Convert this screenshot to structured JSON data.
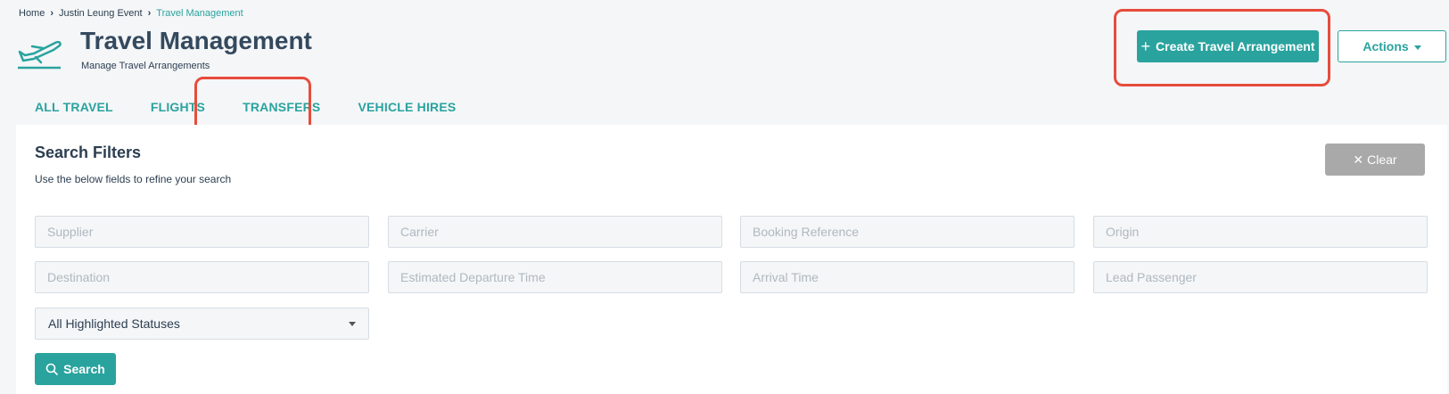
{
  "breadcrumb": {
    "items": [
      "Home",
      "Justin Leung Event",
      "Travel Management"
    ]
  },
  "header": {
    "icon": "plane-icon",
    "title": "Travel Management",
    "subtitle": "Manage Travel Arrangements"
  },
  "toolbar": {
    "create_label": "Create Travel Arrangement",
    "actions_label": "Actions"
  },
  "tabs": [
    {
      "label": "ALL TRAVEL"
    },
    {
      "label": "FLIGHTS"
    },
    {
      "label": "TRANSFERS"
    },
    {
      "label": "VEHICLE HIRES"
    }
  ],
  "filters": {
    "title": "Search Filters",
    "description": "Use the below fields to refine your search",
    "clear_label": "Clear",
    "fields": [
      {
        "placeholder": "Supplier"
      },
      {
        "placeholder": "Carrier"
      },
      {
        "placeholder": "Booking Reference"
      },
      {
        "placeholder": "Origin"
      },
      {
        "placeholder": "Destination"
      },
      {
        "placeholder": "Estimated Departure Time"
      },
      {
        "placeholder": "Arrival Time"
      },
      {
        "placeholder": "Lead Passenger"
      }
    ],
    "status_select": "All Highlighted Statuses",
    "search_label": "Search"
  },
  "colors": {
    "accent": "#2aa39e",
    "highlight": "#e74c3c",
    "clear_button": "#a9a9a9"
  }
}
